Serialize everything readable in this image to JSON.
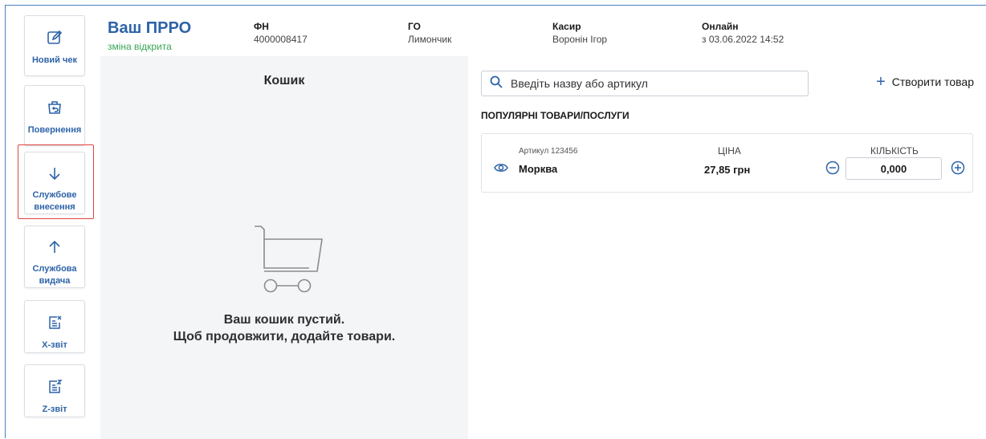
{
  "colors": {
    "accent": "#2d63a8",
    "open_status": "#3aa655",
    "highlight": "#e0453b"
  },
  "sidebar": {
    "items": [
      {
        "label": "Новий чек",
        "icon": "edit-icon"
      },
      {
        "label": "Повернення",
        "icon": "return-basket-icon"
      },
      {
        "label": "Службове внесення",
        "icon": "arrow-down-icon"
      },
      {
        "label": "Службова видача",
        "icon": "arrow-up-icon"
      },
      {
        "label": "X-звіт",
        "icon": "x-report-icon"
      },
      {
        "label": "Z-звіт",
        "icon": "z-report-icon"
      }
    ]
  },
  "header": {
    "title": "Ваш ПРРО",
    "status": "зміна відкрита",
    "fn_label": "ФН",
    "fn_value": "4000008417",
    "go_label": "ГО",
    "go_value": "Лимончик",
    "cashier_label": "Касир",
    "cashier_value": "Воронін Ігор",
    "online_label": "Онлайн",
    "online_value": "з 03.06.2022 14:52"
  },
  "cart": {
    "title": "Кошик",
    "empty_line1": "Ваш кошик пустий.",
    "empty_line2": "Щоб продовжити, додайте товари."
  },
  "search": {
    "placeholder": "Введіть назву або артикул"
  },
  "create_product": {
    "label": "Створити товар"
  },
  "popular": {
    "title": "ПОПУЛЯРНІ ТОВАРИ/ПОСЛУГИ",
    "products": [
      {
        "sku": "Артикул 123456",
        "name": "Морква",
        "price_header": "ЦІНА",
        "price": "27,85 грн",
        "qty_header": "КІЛЬКІСТЬ",
        "qty": "0,000"
      }
    ]
  }
}
